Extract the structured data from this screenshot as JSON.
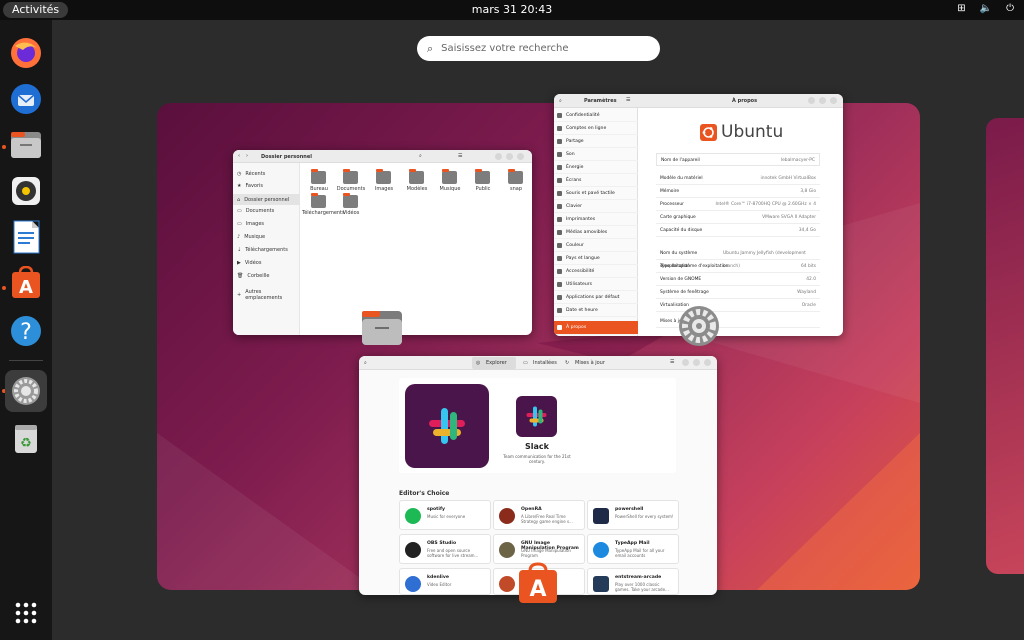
{
  "topbar": {
    "activities": "Activités",
    "clock": "mars 31  20:43"
  },
  "dock": {
    "items": [
      {
        "name": "firefox-icon",
        "running": false
      },
      {
        "name": "thunderbird-icon",
        "running": false
      },
      {
        "name": "files-icon",
        "running": true
      },
      {
        "name": "rhythmbox-icon",
        "running": false
      },
      {
        "name": "writer-icon",
        "running": false
      },
      {
        "name": "app-center-icon",
        "running": true
      },
      {
        "name": "help-icon",
        "running": false
      },
      {
        "name": "settings-icon",
        "running": true
      },
      {
        "name": "trash-icon",
        "running": false
      }
    ]
  },
  "search": {
    "placeholder": "Saisissez votre recherche"
  },
  "files_window": {
    "title": "Dossier personnel",
    "sidebar": [
      "Récents",
      "Favoris",
      "Dossier personnel",
      "Documents",
      "Images",
      "Musique",
      "Téléchargements",
      "Vidéos",
      "Corbeille",
      "Autres emplacements"
    ],
    "folders": [
      "Bureau",
      "Documents",
      "Images",
      "Modèles",
      "Musique",
      "Public",
      "snap",
      "Téléchargements",
      "Vidéos"
    ]
  },
  "settings_window": {
    "sidebar_title": "Paramètres",
    "panel_title": "À propos",
    "menu": [
      "Confidentialité",
      "Comptes en ligne",
      "Partage",
      "Son",
      "Énergie",
      "Écrans",
      "Souris et pavé tactile",
      "Clavier",
      "Imprimantes",
      "Médias amovibles",
      "Couleur",
      "Pays et langue",
      "Accessibilité",
      "Utilisateurs",
      "Applications par défaut",
      "Date et heure",
      "À propos"
    ],
    "logo_text": "Ubuntu",
    "rows": [
      {
        "label": "Nom de l'appareil",
        "value": "lebalmacyer-PC"
      },
      {
        "label": "Modèle du matériel",
        "value": "innotek GmbH VirtualBox"
      },
      {
        "label": "Mémoire",
        "value": "3,8 Gio"
      },
      {
        "label": "Processeur",
        "value": "Intel® Core™ i7-8700HQ CPU @ 2.60GHz × 4"
      },
      {
        "label": "Carte graphique",
        "value": "VMware SVGA II Adapter"
      },
      {
        "label": "Capacité du disque",
        "value": "34,4 Go"
      },
      {
        "label": "Nom du système d'exploitation",
        "value": "Ubuntu Jammy Jellyfish (development branch)"
      },
      {
        "label": "Type de système d'exploitation",
        "value": "64 bits"
      },
      {
        "label": "Version de GNOME",
        "value": "42.0"
      },
      {
        "label": "Système de fenêtrage",
        "value": "Wayland"
      },
      {
        "label": "Virtualisation",
        "value": "Oracle"
      },
      {
        "label": "Mises à jour",
        "value": ""
      }
    ]
  },
  "store_window": {
    "tabs": [
      "Explorer",
      "Installées",
      "Mises à jour"
    ],
    "featured": {
      "name": "Slack",
      "desc": "Team communication for the 21st century."
    },
    "section": "Editor's Choice",
    "apps": [
      {
        "name": "spotify",
        "desc": "Music for everyone",
        "color": "#1db954"
      },
      {
        "name": "OpenRA",
        "desc": "A Libre/Free Real Time Strategy game engine s...",
        "color": "#8b2b1b"
      },
      {
        "name": "powershell",
        "desc": "PowerShell for every system!",
        "color": "#1e2a47"
      },
      {
        "name": "OBS Studio",
        "desc": "Free and open source software for live stream...",
        "color": "#222222"
      },
      {
        "name": "GNU Image Manipulation Program",
        "desc": "GNU Image Manipulation Program",
        "color": "#6d6448"
      },
      {
        "name": "TypeApp Mail",
        "desc": "TypeApp Mail for all your email accounts",
        "color": "#1d8ae0"
      },
      {
        "name": "kdenlive",
        "desc": "Video Editor",
        "color": "#2f6fd4"
      },
      {
        "name": "...pedi...",
        "desc": "...view a...",
        "color": "#c14b28"
      },
      {
        "name": "entstream-arcade",
        "desc": "Play over 1000 classic games. Take your arcade...",
        "color": "#243b5a"
      }
    ]
  }
}
